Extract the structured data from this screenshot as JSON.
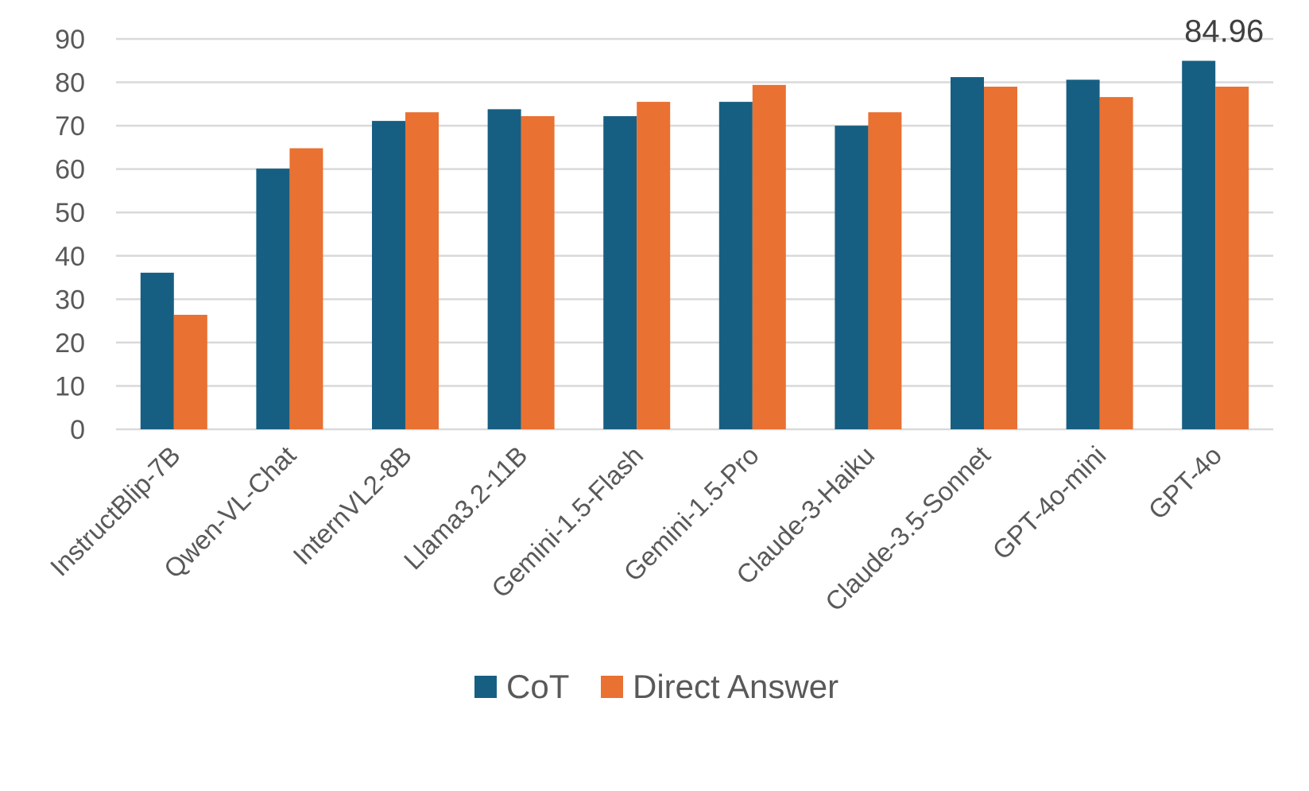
{
  "chart_data": {
    "type": "bar",
    "title": "",
    "xlabel": "",
    "ylabel": "",
    "ylim": [
      0,
      90
    ],
    "yticks": [
      0,
      10,
      20,
      30,
      40,
      50,
      60,
      70,
      80,
      90
    ],
    "grid": true,
    "legend_position": "bottom",
    "categories": [
      "InstructBlip-7B",
      "Qwen-VL-Chat",
      "InternVL2-8B",
      "Llama3.2-11B",
      "Gemini-1.5-Flash",
      "Gemini-1.5-Pro",
      "Claude-3-Haiku",
      "Claude-3.5-Sonnet",
      "GPT-4o-mini",
      "GPT-4o"
    ],
    "series": [
      {
        "name": "CoT",
        "color": "#175f82",
        "values": [
          36.1,
          60.1,
          71.1,
          73.8,
          72.2,
          75.5,
          70.0,
          81.2,
          80.6,
          84.96
        ]
      },
      {
        "name": "Direct Answer",
        "color": "#e97132",
        "values": [
          26.4,
          64.8,
          73.1,
          72.2,
          75.5,
          79.4,
          73.1,
          79.0,
          76.6,
          79.0
        ]
      }
    ],
    "annotations": [
      {
        "category": "GPT-4o",
        "series": "CoT",
        "text": "84.96"
      }
    ]
  }
}
